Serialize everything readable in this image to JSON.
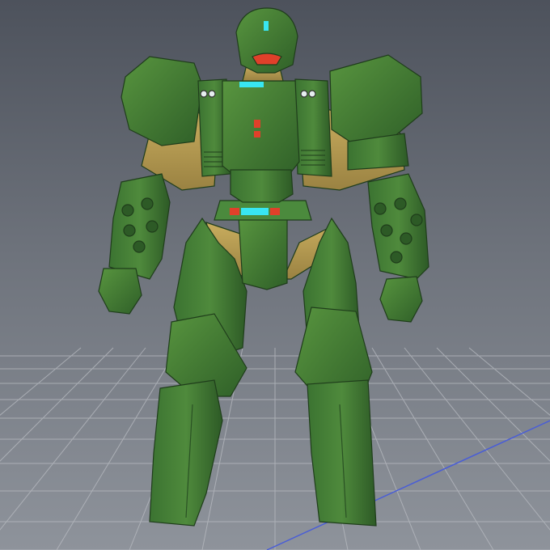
{
  "viewport": {
    "background_top": "#4d525c",
    "background_bottom": "#8e939b",
    "grid_color": "#b9bcc2",
    "axis_color": "#4a5ed6"
  },
  "model": {
    "armor_color": "#3f7a35",
    "armor_shadow": "#2d5a26",
    "undersuit_color": "#b39a52",
    "light_cyan": "#38e6f2",
    "light_red": "#e0402a"
  }
}
